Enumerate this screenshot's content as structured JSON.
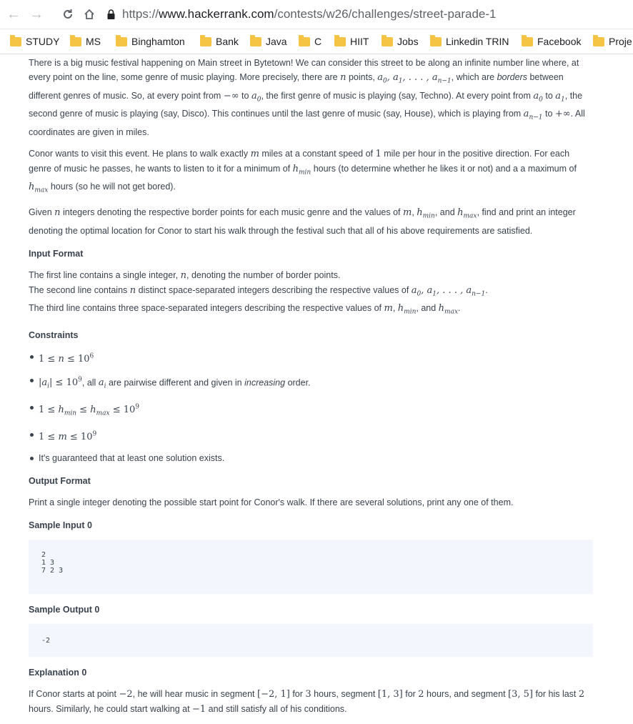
{
  "browser": {
    "url_scheme": "https://",
    "url_host": "www.hackerrank.com",
    "url_path": "/contests/w26/challenges/street-parade-1",
    "back_icon": "arrow-left-icon",
    "forward_icon": "arrow-right-icon",
    "reload_icon": "reload-icon",
    "home_icon": "home-icon",
    "lock_icon": "lock-icon"
  },
  "bookmarks": [
    "STUDY",
    "MS",
    "Binghamton",
    "Bank",
    "Java",
    "C",
    "HIIT",
    "Jobs",
    "Linkedin TRIN",
    "Facebook",
    "Proje"
  ],
  "problem": {
    "p1": {
      "a": "There is a big music festival happening on Main street in Bytetown! We can consider this street to be along an infinite number line where, at every point on the line, some genre of music playing. More precisely, there are ",
      "b": " points, ",
      "c": ", which are ",
      "d": "borders",
      "e": " between different genres of music. So, at every point from ",
      "f": " to ",
      "g": ", the first genre of music is playing (say, Techno). At every point from ",
      "h": " to ",
      "i": ", the second genre of music is playing (say, Disco). This continues until the last genre of music (say, House), which is playing from ",
      "j": " to ",
      "k": ". All coordinates are given in miles."
    },
    "p2": {
      "a": "Conor wants to visit this event. He plans to walk exactly ",
      "b": " miles at a constant speed of ",
      "c": " mile per hour in the positive direction. For each genre of music he passes, he wants to listen to it for a minimum of ",
      "d": " hours (to determine whether he likes it or not) and a a maximum of ",
      "e": " hours (so he will not get bored)."
    },
    "p3": {
      "a": "Given ",
      "b": " integers denoting the respective border points for each music genre and the values of ",
      "c": ", ",
      "d": ", and ",
      "e": ", find and print an integer denoting the optimal location for Conor to start his walk through the festival such that all of his above requirements are satisfied."
    },
    "input_heading": "Input Format",
    "input": {
      "l1a": "The first line contains a single integer, ",
      "l1b": ", denoting the number of border points.",
      "l2a": "The second line contains ",
      "l2b": " distinct space-separated integers describing the respective values of ",
      "l2c": ".",
      "l3a": "The third line contains three space-separated integers describing the respective values of ",
      "l3b": ", ",
      "l3c": ", and ",
      "l3d": "."
    },
    "constraints_heading": "Constraints",
    "constraints": {
      "c2a": ", all ",
      "c2b": " are pairwise different and given in ",
      "c2c": "increasing",
      "c2d": " order.",
      "c5": "It's guaranteed that at least one solution exists."
    },
    "output_heading": "Output Format",
    "output_text": "Print a single integer denoting the possible start point for Conor's walk. If there are several solutions, print any one of them.",
    "sample_input_heading": "Sample Input 0",
    "sample_input": "2\n1 3\n7 2 3",
    "sample_output_heading": "Sample Output 0",
    "sample_output": "-2",
    "explanation_heading": "Explanation 0",
    "explanation": {
      "a": "If Conor starts at point ",
      "b": ", he will hear music in segment ",
      "c": " for ",
      "d": " hours, segment ",
      "e": " for ",
      "f": " hours, and segment ",
      "g": " for his last ",
      "h": " hours. Similarly, he could start walking at ",
      "i": " and still satisfy all of his conditions."
    }
  }
}
